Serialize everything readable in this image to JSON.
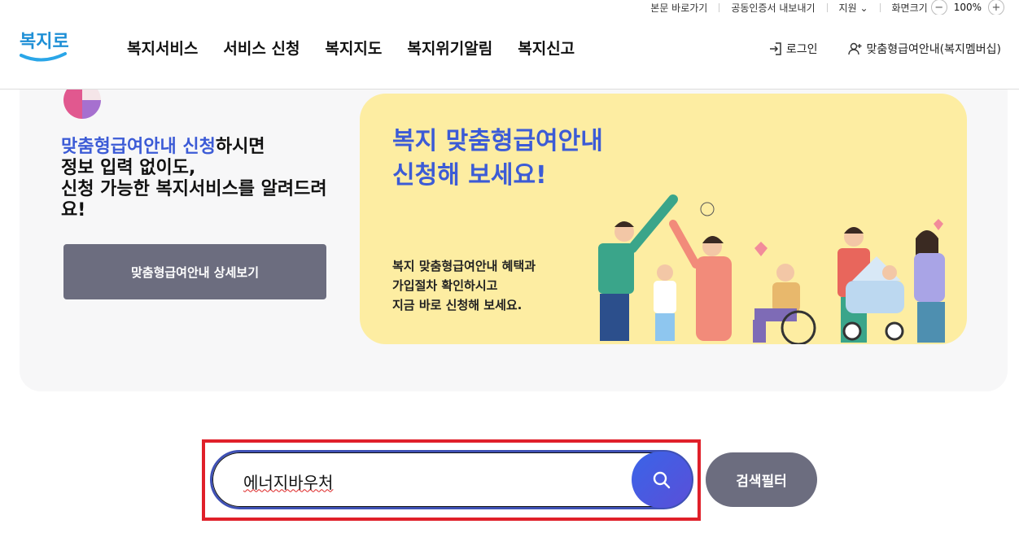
{
  "util": {
    "skip": "본문 바로가기",
    "cert": "공동인증서 내보내기",
    "lang": "지원",
    "zoom_label": "화면크기",
    "zoom_minus": "−",
    "zoom_value": "100%",
    "zoom_plus": "+"
  },
  "header": {
    "logo_text": "복지로",
    "nav": [
      "복지서비스",
      "서비스 신청",
      "복지지도",
      "복지위기알림",
      "복지신고"
    ],
    "login": "로그인",
    "membership": "맞춤형급여안내(복지멤버십)"
  },
  "intro": {
    "highlight": "맞춤형급여안내 신청",
    "line1_rest": "하시면",
    "line2": "정보 입력 없이도,",
    "line3": "신청 가능한 복지서비스를 알려드려요!",
    "button": "맞춤형급여안내 상세보기"
  },
  "banner": {
    "title_line1": "복지 맞춤형급여안내",
    "title_line2": "신청해 보세요!",
    "desc_line1": "복지 맞춤형급여안내 혜택과",
    "desc_line2": "가입절차 확인하시고",
    "desc_line3": "지금 바로 신청해 보세요."
  },
  "search": {
    "value": "에너지바우처",
    "filter": "검색필터"
  },
  "colors": {
    "accent_blue": "#3c5bd6",
    "button_gray": "#6c6d7f",
    "banner_bg": "#fdeda2",
    "focus_red": "#e0202a"
  }
}
